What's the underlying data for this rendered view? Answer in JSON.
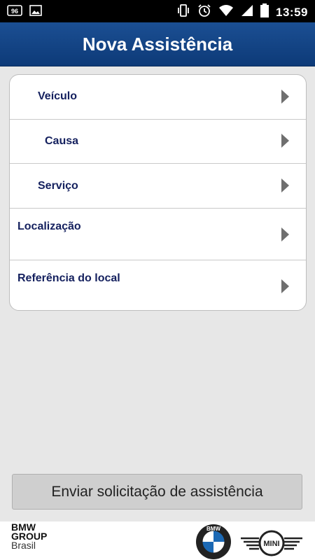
{
  "status_bar": {
    "time": "13:59",
    "left_icons": [
      "signal-96-icon",
      "image-icon"
    ],
    "right_icons": [
      "vibrate-icon",
      "alarm-icon",
      "wifi-icon",
      "cell-signal-icon",
      "battery-icon"
    ]
  },
  "header": {
    "title": "Nova Assistência",
    "color": "#15468a"
  },
  "form": {
    "rows": [
      {
        "label": "Veículo",
        "icon": "chevron-right-icon"
      },
      {
        "label": "Causa",
        "icon": "chevron-right-icon"
      },
      {
        "label": "Serviço",
        "icon": "chevron-right-icon"
      },
      {
        "label": "Localização",
        "icon": "chevron-right-icon"
      },
      {
        "label": "Referência do local",
        "icon": "chevron-right-icon"
      }
    ],
    "label_color": "#14205e"
  },
  "actions": {
    "submit_label": "Enviar solicitação de assistência"
  },
  "footer": {
    "group_logo_lines": [
      "BMW",
      "GROUP",
      "Brasil"
    ],
    "bmw_logo_text": "BMW",
    "mini_logo_text": "MINI"
  }
}
